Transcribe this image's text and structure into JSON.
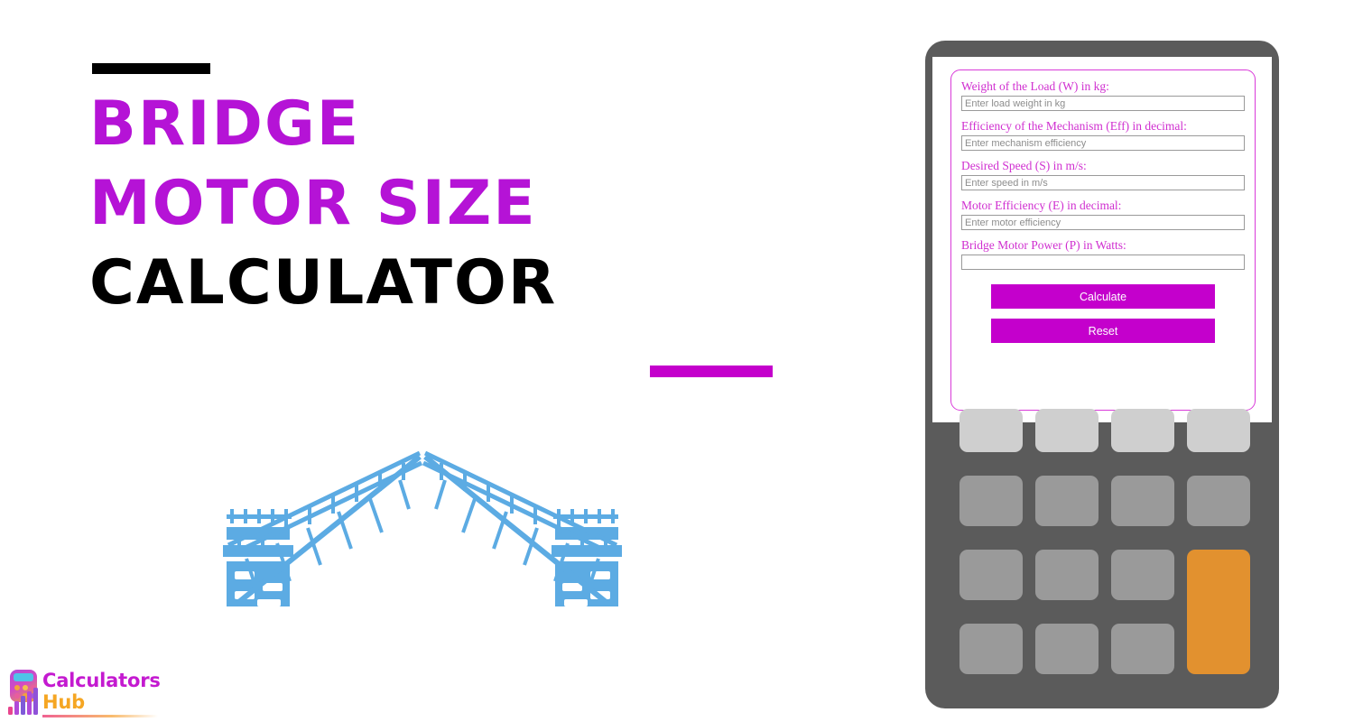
{
  "page": {
    "background": "#ffffff",
    "accent_purple": "#b513d6",
    "accent_magenta": "#c400cc",
    "bridge_blue": "#5cabe3",
    "device_gray": "#5b5b5b"
  },
  "title": {
    "line1": "BRIDGE",
    "line2": "MOTOR SIZE",
    "line3": "CALCULATOR",
    "top_bar_color": "#000000",
    "bottom_bar_color": "#c400cc"
  },
  "illustration": {
    "name": "drawbridge",
    "color": "#5cabe3",
    "description": "Raised drawbridge with two towers and open spans"
  },
  "logo": {
    "name_primary": "Calculators",
    "name_secondary": "Hub",
    "primary_color": "#c41ad0",
    "secondary_color": "#f5a623",
    "icon": "calculator-bars-icon"
  },
  "calculator": {
    "shell_color": "#5b5b5b",
    "form": {
      "border_color": "#d93ad9",
      "fields": [
        {
          "label": "Weight of the Load (W) in kg:",
          "placeholder": "Enter load weight in kg",
          "value": ""
        },
        {
          "label": "Efficiency of the Mechanism (Eff) in decimal:",
          "placeholder": "Enter mechanism efficiency",
          "value": ""
        },
        {
          "label": "Desired Speed (S) in m/s:",
          "placeholder": "Enter speed in m/s",
          "value": ""
        },
        {
          "label": "Motor Efficiency (E) in decimal:",
          "placeholder": "Enter motor efficiency",
          "value": ""
        },
        {
          "label": "Bridge Motor Power (P) in Watts:",
          "placeholder": "",
          "value": ""
        }
      ],
      "buttons": {
        "calculate": "Calculate",
        "reset": "Reset"
      },
      "button_color": "#c400cc"
    },
    "keypad": {
      "rows": 4,
      "columns": 4,
      "top_row_color": "#cfcfcf",
      "key_color": "#9a9a9a",
      "accent_key_color": "#e2912f",
      "accent_key_position": "last-column-rows-3-4"
    }
  }
}
